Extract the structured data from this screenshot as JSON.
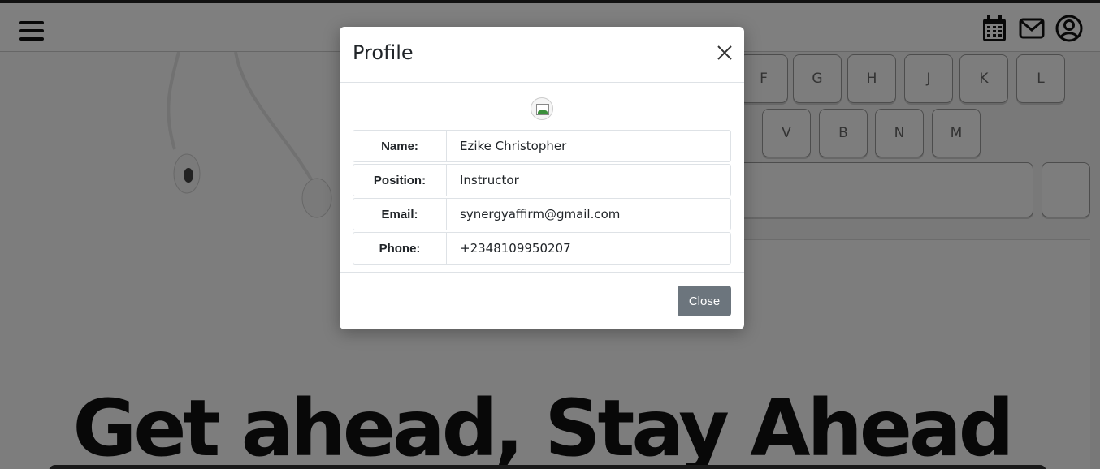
{
  "hero": {
    "headline": "Get ahead, Stay Ahead",
    "keys_row1": [
      "F",
      "G",
      "H",
      "J",
      "K",
      "L"
    ],
    "keys_row2": [
      "V",
      "B",
      "N",
      "M"
    ]
  },
  "navbar": {
    "menu_icon": "hamburger-icon",
    "icons": [
      "calendar-icon",
      "mail-icon",
      "user-circle-icon"
    ]
  },
  "modal": {
    "title": "Profile",
    "rows": [
      {
        "label": "Name:",
        "value": "Ezike Christopher"
      },
      {
        "label": "Position:",
        "value": "Instructor"
      },
      {
        "label": "Email:",
        "value": "synergyaffirm@gmail.com"
      },
      {
        "label": "Phone:",
        "value": "+2348109950207"
      }
    ],
    "close_label": "Close"
  },
  "colors": {
    "button_secondary": "#6c757d",
    "backdrop": "rgba(0,0,0,0.5)"
  }
}
